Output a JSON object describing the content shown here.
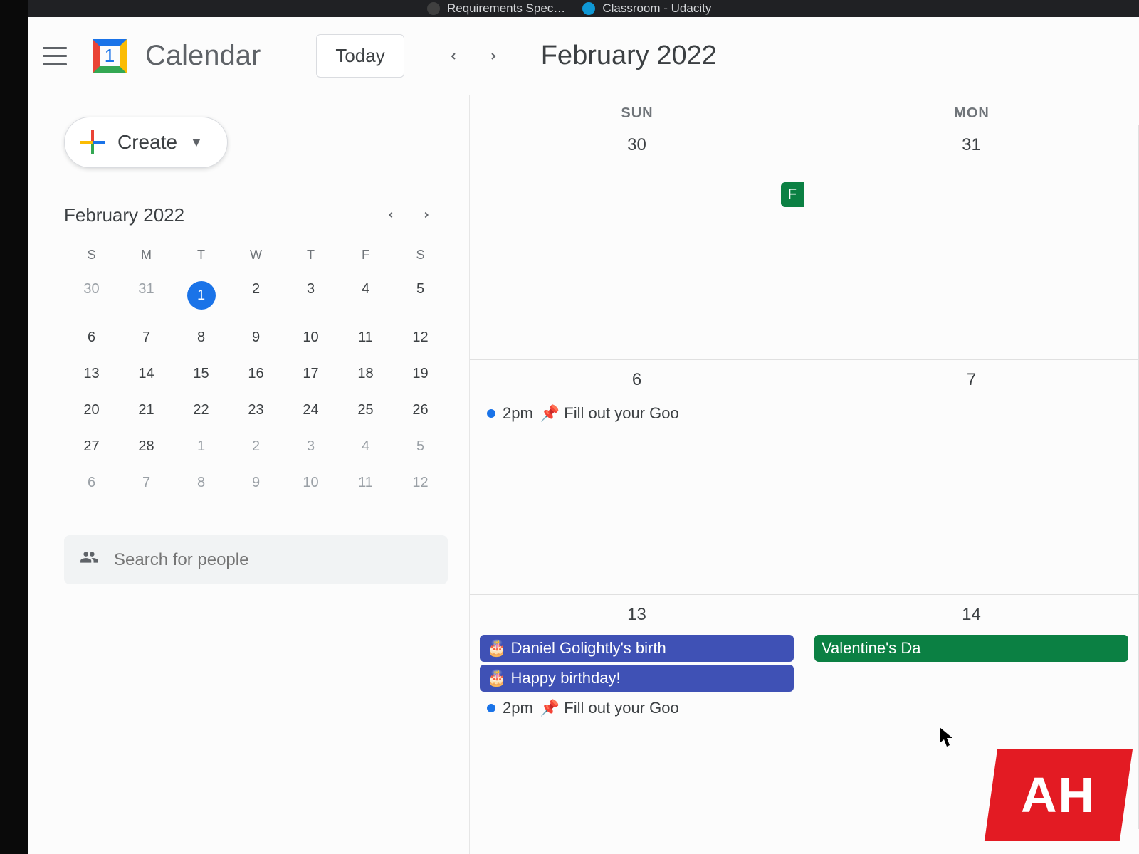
{
  "browser": {
    "tabs": [
      {
        "label": "Requirements Spec…"
      },
      {
        "label": "Classroom - Udacity"
      }
    ]
  },
  "header": {
    "app_name": "Calendar",
    "logo_day": "1",
    "today_label": "Today",
    "current_period": "February 2022"
  },
  "sidebar": {
    "create_label": "Create",
    "minical": {
      "title": "February 2022",
      "dow": [
        "S",
        "M",
        "T",
        "W",
        "T",
        "F",
        "S"
      ],
      "rows": [
        [
          {
            "n": "30",
            "dim": true
          },
          {
            "n": "31",
            "dim": true
          },
          {
            "n": "1",
            "today": true
          },
          {
            "n": "2"
          },
          {
            "n": "3"
          },
          {
            "n": "4"
          },
          {
            "n": "5"
          }
        ],
        [
          {
            "n": "6"
          },
          {
            "n": "7"
          },
          {
            "n": "8"
          },
          {
            "n": "9"
          },
          {
            "n": "10"
          },
          {
            "n": "11"
          },
          {
            "n": "12"
          }
        ],
        [
          {
            "n": "13"
          },
          {
            "n": "14"
          },
          {
            "n": "15"
          },
          {
            "n": "16"
          },
          {
            "n": "17"
          },
          {
            "n": "18"
          },
          {
            "n": "19"
          }
        ],
        [
          {
            "n": "20"
          },
          {
            "n": "21"
          },
          {
            "n": "22"
          },
          {
            "n": "23"
          },
          {
            "n": "24"
          },
          {
            "n": "25"
          },
          {
            "n": "26"
          }
        ],
        [
          {
            "n": "27"
          },
          {
            "n": "28"
          },
          {
            "n": "1",
            "dim": true
          },
          {
            "n": "2",
            "dim": true
          },
          {
            "n": "3",
            "dim": true
          },
          {
            "n": "4",
            "dim": true
          },
          {
            "n": "5",
            "dim": true
          }
        ],
        [
          {
            "n": "6",
            "dim": true
          },
          {
            "n": "7",
            "dim": true
          },
          {
            "n": "8",
            "dim": true
          },
          {
            "n": "9",
            "dim": true
          },
          {
            "n": "10",
            "dim": true
          },
          {
            "n": "11",
            "dim": true
          },
          {
            "n": "12",
            "dim": true
          }
        ]
      ]
    },
    "search_placeholder": "Search for people"
  },
  "grid": {
    "dow": [
      "SUN",
      "MON"
    ],
    "weeks": [
      {
        "days": [
          {
            "num": "30",
            "events": [],
            "chip": "F"
          },
          {
            "num": "31",
            "events": []
          }
        ]
      },
      {
        "days": [
          {
            "num": "6",
            "events": [
              {
                "type": "timed",
                "time": "2pm",
                "title": "📌 Fill out your Goo"
              }
            ]
          },
          {
            "num": "7",
            "events": []
          }
        ]
      },
      {
        "days": [
          {
            "num": "13",
            "events": [
              {
                "type": "allday",
                "color": "blue",
                "title": "🎂 Daniel Golightly's birth"
              },
              {
                "type": "allday",
                "color": "blue",
                "title": "🎂 Happy birthday!"
              },
              {
                "type": "timed",
                "time": "2pm",
                "title": "📌 Fill out your Goo"
              }
            ]
          },
          {
            "num": "14",
            "events": [
              {
                "type": "allday",
                "color": "green",
                "title": "Valentine's Da"
              }
            ]
          }
        ]
      }
    ]
  },
  "watermark": "AH"
}
